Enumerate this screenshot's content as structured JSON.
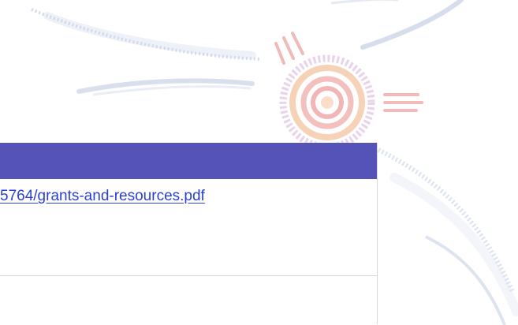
{
  "background": {
    "logo_colors": [
      "#d8c0e6",
      "#f2b98c",
      "#ee9a9a"
    ],
    "swoosh_color": "#b8c4de"
  },
  "table": {
    "header_color": "#5552b8",
    "rows": [
      {
        "link_text": "5764/grants-and-resources.pdf",
        "link_color": "#2b3fd0"
      }
    ]
  }
}
